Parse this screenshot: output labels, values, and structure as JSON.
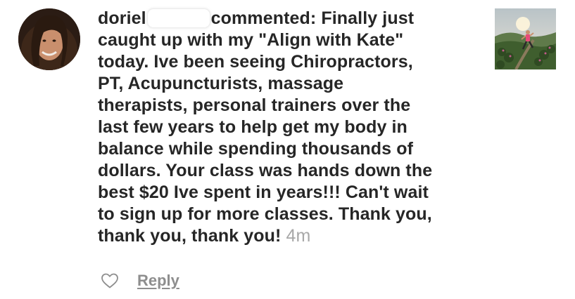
{
  "comment": {
    "username": "doriel",
    "action_text": "commented:",
    "lines": [
      "Finally just",
      "caught up with my \"Align with Kate\"",
      "today.  Ive been seeing Chiropractors,",
      "PT, Acupuncturists, massage",
      "therapists, personal trainers over the",
      "last few years to help get my body in",
      "balance while spending thousands of",
      "dollars.  Your class was hands down the",
      "best $20 Ive spent in years!!! Can't wait",
      "to sign up for more classes.  Thank you,",
      "thank you, thank you!"
    ],
    "timestamp": "4m"
  },
  "actions": {
    "like_icon": "heart-outline-icon",
    "reply_label": "Reply"
  },
  "colors": {
    "text": "#262626",
    "muted": "#a8a8a8",
    "reply": "#8e8e8e",
    "background": "#ffffff"
  }
}
